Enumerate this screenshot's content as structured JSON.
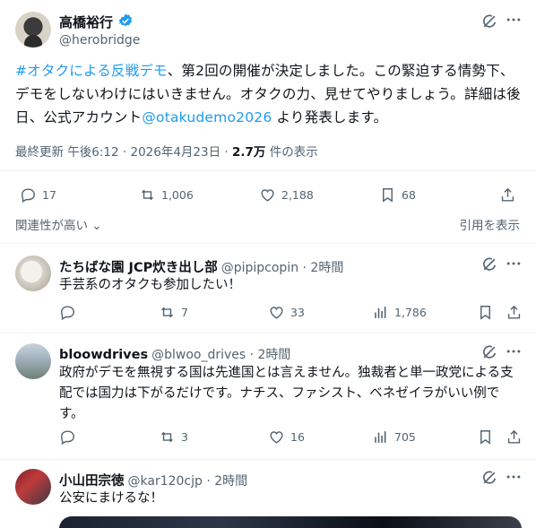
{
  "main_post": {
    "author": "高橋裕行",
    "handle": "@herobridge",
    "text_hashtag": "#オタクによる反戦デモ",
    "text_body": "、第2回の開催が決定しました。この緊迫する情勢下、デモをしないわけにはいきません。オタクの力、見せてやりましょう。詳細は後日、公式アカウント",
    "text_mention": "@otakudemo2026",
    "text_tail": " より発表します。",
    "meta_prefix": "最終更新 午後6:12 · 2026年4月23日 · ",
    "views": "2.7万",
    "views_suffix": " 件の表示",
    "stats": {
      "replies": "17",
      "reposts": "1,006",
      "likes": "2,188",
      "bookmarks": "68"
    },
    "relevance_label": "関連性が高い",
    "quotes_label": "引用を表示"
  },
  "replies": [
    {
      "name": "たちばな園 JCP炊き出し部",
      "handle": "@pipipcopin · 2時間",
      "text": "手芸系のオタクも参加したい！",
      "stats": {
        "replies": "",
        "reposts": "7",
        "likes": "33",
        "views": "1,786"
      }
    },
    {
      "name": "bloowdrives",
      "handle": "@blwoo_drives · 2時間",
      "text": "政府がデモを無視する国は先進国とは言えません。独裁者と単一政党による支配では国力は下がるだけです。ナチス、ファシスト、ベネゼイラがいい例です。",
      "stats": {
        "replies": "",
        "reposts": "3",
        "likes": "16",
        "views": "705"
      }
    },
    {
      "name": "小山田宗徳",
      "handle": "@kar120cjp · 2時間",
      "text": "公安にまけるな！"
    }
  ],
  "colors": {
    "accent": "#1d9bf0",
    "muted": "#536471",
    "text": "#0f1419",
    "divider": "#eff3f4"
  }
}
